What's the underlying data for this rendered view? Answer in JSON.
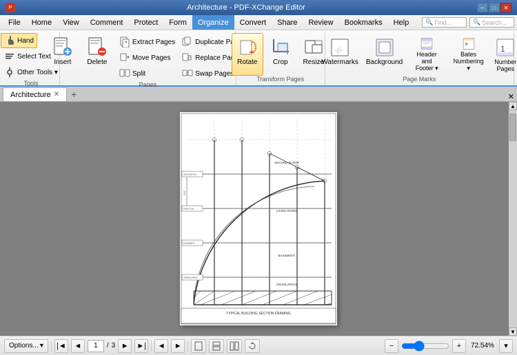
{
  "titlebar": {
    "title": "Architecture - PDF-XChange Editor",
    "min_label": "─",
    "max_label": "□",
    "close_label": "✕"
  },
  "menubar": {
    "items": [
      "File",
      "Home",
      "View",
      "Comment",
      "Protect",
      "Form",
      "Organize",
      "Convert",
      "Share",
      "Review",
      "Bookmarks",
      "Help"
    ],
    "active": "Organize",
    "find_placeholder": "Find...",
    "search_placeholder": "Search..."
  },
  "ribbon": {
    "groups": [
      {
        "label": "Pages",
        "buttons_large": [
          {
            "id": "insert",
            "label": "Insert"
          },
          {
            "id": "delete",
            "label": "Delete"
          }
        ],
        "buttons_small_cols": [
          [
            {
              "id": "extract-pages",
              "label": "Extract Pages"
            },
            {
              "id": "move-pages",
              "label": "Move Pages"
            },
            {
              "id": "split",
              "label": "Split"
            }
          ],
          [
            {
              "id": "duplicate-pages",
              "label": "Duplicate Pages"
            },
            {
              "id": "replace-pages",
              "label": "Replace Pages"
            },
            {
              "id": "swap-pages",
              "label": "Swap Pages"
            }
          ]
        ]
      },
      {
        "label": "Transform Pages",
        "buttons_large": [
          {
            "id": "rotate",
            "label": "Rotate",
            "active": true
          },
          {
            "id": "crop",
            "label": "Crop"
          },
          {
            "id": "resize",
            "label": "Resize"
          }
        ]
      },
      {
        "label": "Page Marks",
        "buttons_large": [
          {
            "id": "watermarks",
            "label": "Watermarks"
          },
          {
            "id": "background",
            "label": "Background"
          },
          {
            "id": "header-footer",
            "label": "Header and\nFooter ▾"
          },
          {
            "id": "bates-numbering",
            "label": "Bates\nNumbering ▾"
          },
          {
            "id": "number-pages",
            "label": "Number\nPages"
          }
        ]
      }
    ]
  },
  "tools": {
    "hand": "Hand",
    "select_text": "Select Text",
    "other_tools": "Other Tools ▾"
  },
  "tab": {
    "name": "Architecture",
    "close": "✕"
  },
  "statusbar": {
    "options": "Options...",
    "page_current": "1",
    "page_total": "3",
    "zoom": "72.54%",
    "fit_page": "⊞",
    "fit_width": "⊟"
  },
  "pdf": {
    "title": "TYPICAL BUILDING SECTION FRAMING"
  }
}
